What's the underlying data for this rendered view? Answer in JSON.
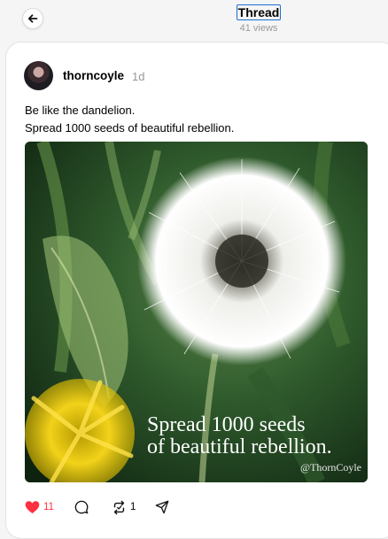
{
  "header": {
    "title": "Thread",
    "views": "41 views"
  },
  "post": {
    "username": "thorncoyle",
    "time": "1d",
    "text_lines": [
      "Be like the dandelion.",
      "Spread 1000 seeds of beautiful rebellion."
    ],
    "image": {
      "overlay_line1": "Spread 1000 seeds",
      "overlay_line2": "of beautiful rebellion.",
      "watermark": "@ThornCoyle"
    },
    "actions": {
      "like_count": "11",
      "repost_count": "1",
      "liked": true
    }
  },
  "icons": {
    "back": "arrow-left-icon",
    "like": "heart-icon",
    "comment": "comment-icon",
    "repost": "repost-icon",
    "share": "send-icon"
  },
  "colors": {
    "accent_like": "#ff3040",
    "focus_ring": "#1f6fd1",
    "muted": "#999999"
  }
}
